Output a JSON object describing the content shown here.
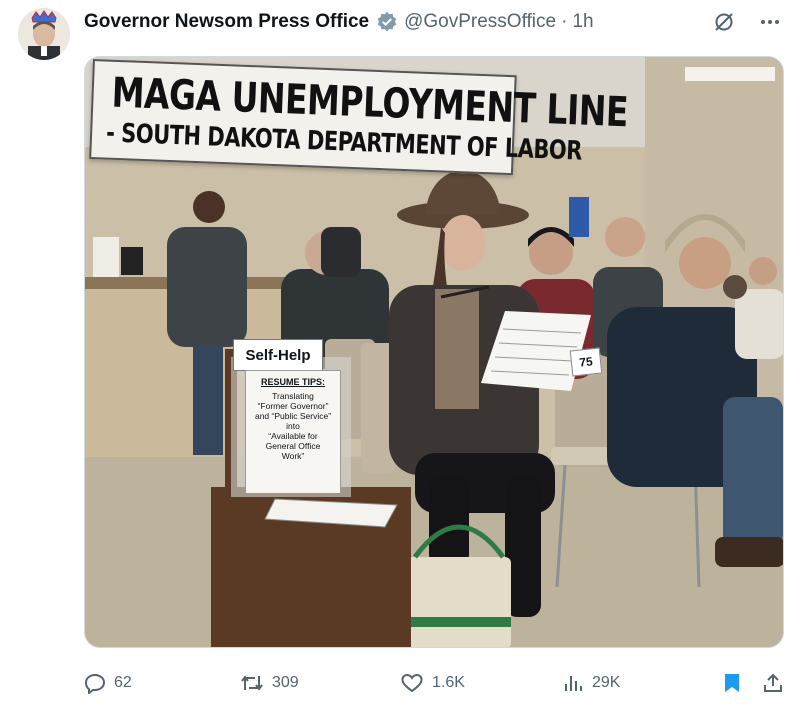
{
  "post": {
    "author_name": "Governor Newsom Press Office",
    "handle": "@GovPressOffice",
    "separator": "·",
    "time": "1h"
  },
  "image": {
    "sign_line1": "MAGA UNEMPLOYMENT LINE",
    "sign_line2": "- SOUTH DAKOTA DEPARTMENT OF LABOR",
    "self_help_label": "Self-Help",
    "resume_tips_title": "RESUME TIPS:",
    "resume_tips_body": "Translating\n“Former Governor”\nand “Public Service”\ninto\n“Available for\nGeneral Office\nWork”",
    "ticket_number": "75"
  },
  "actions": {
    "replies": "62",
    "reposts": "309",
    "likes": "1.6K",
    "views": "29K"
  },
  "icons": [
    "verified-badge-icon",
    "grok-icon",
    "more-icon",
    "reply-icon",
    "repost-icon",
    "like-icon",
    "views-icon",
    "bookmark-icon",
    "share-icon"
  ],
  "colors": {
    "verified": "#829aab",
    "bookmark": "#1d9bf0",
    "muted": "#536471"
  }
}
